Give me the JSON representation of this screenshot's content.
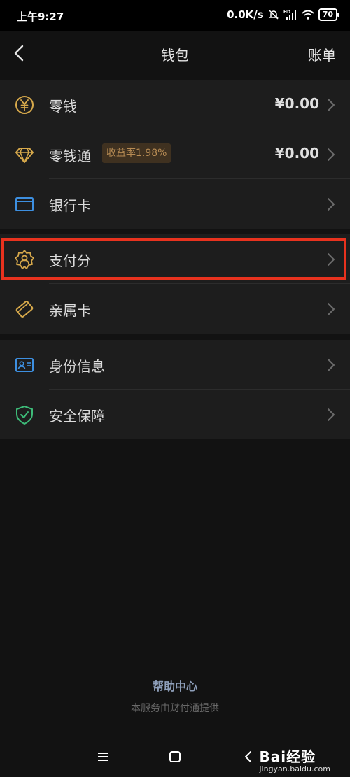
{
  "status_bar": {
    "time": "上午9:27",
    "net_speed": "0.0K/s",
    "battery": "70",
    "icons": [
      "mute-bell-icon",
      "hd-signal-icon",
      "wifi-icon",
      "battery-icon"
    ]
  },
  "nav": {
    "title": "钱包",
    "right_action": "账单",
    "back_icon": "chevron-left-icon"
  },
  "groups": [
    {
      "items": [
        {
          "label": "零钱",
          "value": "¥0.00",
          "icon": "yuan-coin-icon"
        },
        {
          "label": "零钱通",
          "badge": "收益率1.98%",
          "value": "¥0.00",
          "icon": "diamond-icon"
        },
        {
          "label": "银行卡",
          "icon": "bank-card-icon"
        }
      ]
    },
    {
      "items": [
        {
          "label": "支付分",
          "icon": "credit-score-gear-icon",
          "highlighted": true
        },
        {
          "label": "亲属卡",
          "icon": "family-card-icon"
        }
      ]
    },
    {
      "items": [
        {
          "label": "身份信息",
          "icon": "id-card-icon"
        },
        {
          "label": "安全保障",
          "icon": "shield-check-icon"
        }
      ]
    }
  ],
  "footer": {
    "help_link": "帮助中心",
    "provider_note": "本服务由财付通提供"
  },
  "system_nav": {
    "icons": [
      "menu-icon",
      "home-square-icon",
      "back-triangle-icon"
    ]
  },
  "watermark": {
    "brand": "Bai经验",
    "url": "jingyan.baidu.com"
  },
  "colors": {
    "background": "#121212",
    "row_background": "#1d1d1d",
    "accent_gold": "#d7a94b",
    "accent_blue": "#3d8fe0",
    "accent_green": "#3dbb78",
    "highlight_red": "#e8321e"
  }
}
